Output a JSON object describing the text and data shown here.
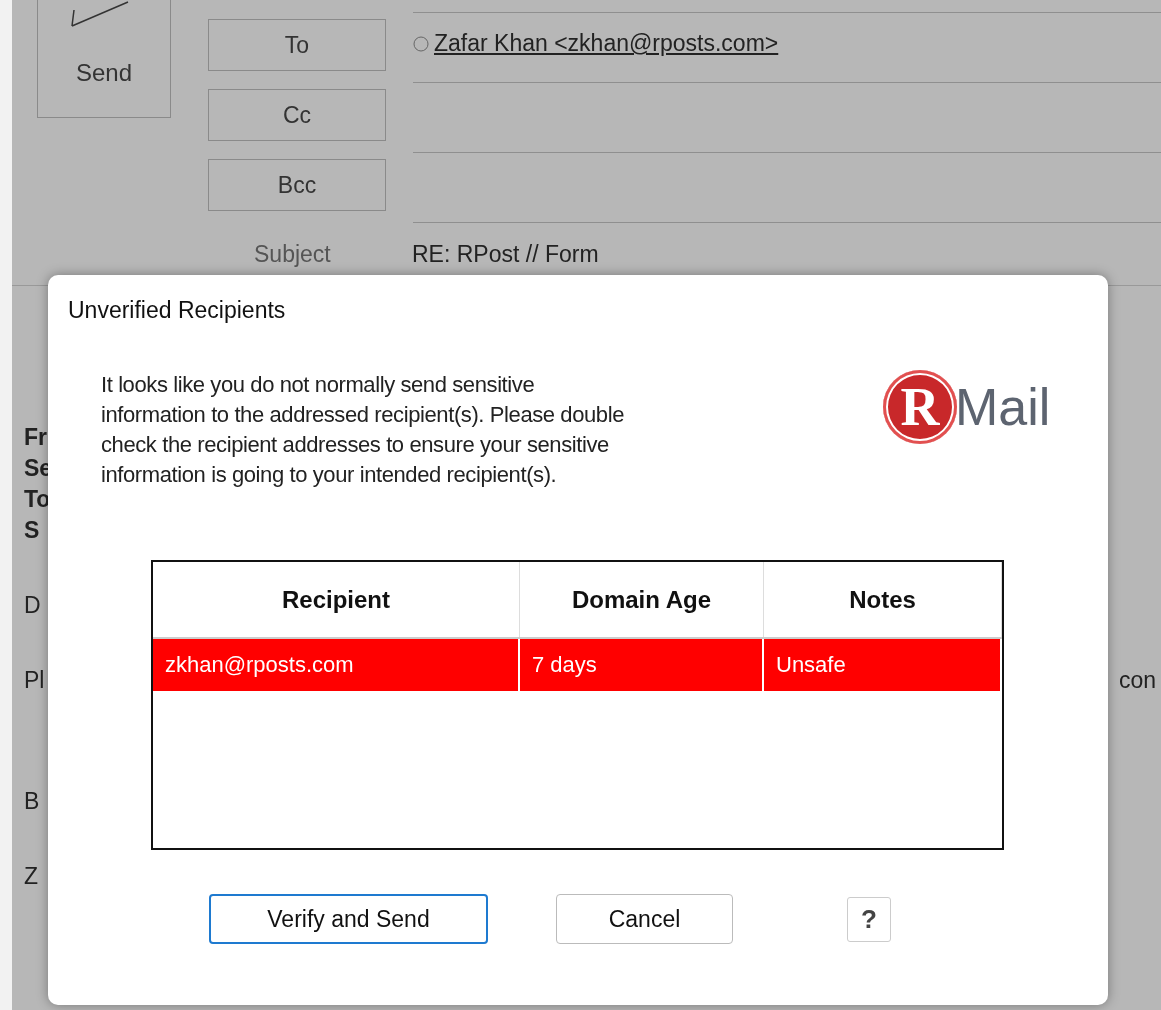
{
  "compose": {
    "send_label": "Send",
    "address_buttons": [
      "To",
      "Cc",
      "Bcc"
    ],
    "to_recipients": [
      "Zafar Khan <zkhan@rposts.com>"
    ],
    "subject_label": "Subject",
    "subject": "RE: RPost // Form"
  },
  "body_fragments": {
    "header_lines": [
      "Fr",
      "Se",
      "To",
      "S"
    ],
    "lines": [
      {
        "left": "D"
      },
      {
        "left": "Pl",
        "right": "con"
      },
      {
        "left": "B"
      },
      {
        "left": "Z"
      }
    ]
  },
  "dialog": {
    "title": "Unverified Recipients",
    "message_lines": [
      "It looks like you do not normally send sensitive",
      "information to the addressed recipient(s). Please double",
      "check the recipient addresses to ensure your sensitive",
      "information is going to your intended recipient(s)."
    ],
    "logo": {
      "mark": "R",
      "text": "Mail"
    },
    "table": {
      "columns": [
        "Recipient",
        "Domain Age",
        "Notes"
      ],
      "rows": [
        {
          "cells": [
            "zkhan@rposts.com",
            "7 days",
            "Unsafe"
          ],
          "unsafe": true
        }
      ]
    },
    "buttons": [
      {
        "label": "Verify and Send",
        "default": true
      },
      {
        "label": "Cancel",
        "default": false
      }
    ],
    "help": "?"
  }
}
